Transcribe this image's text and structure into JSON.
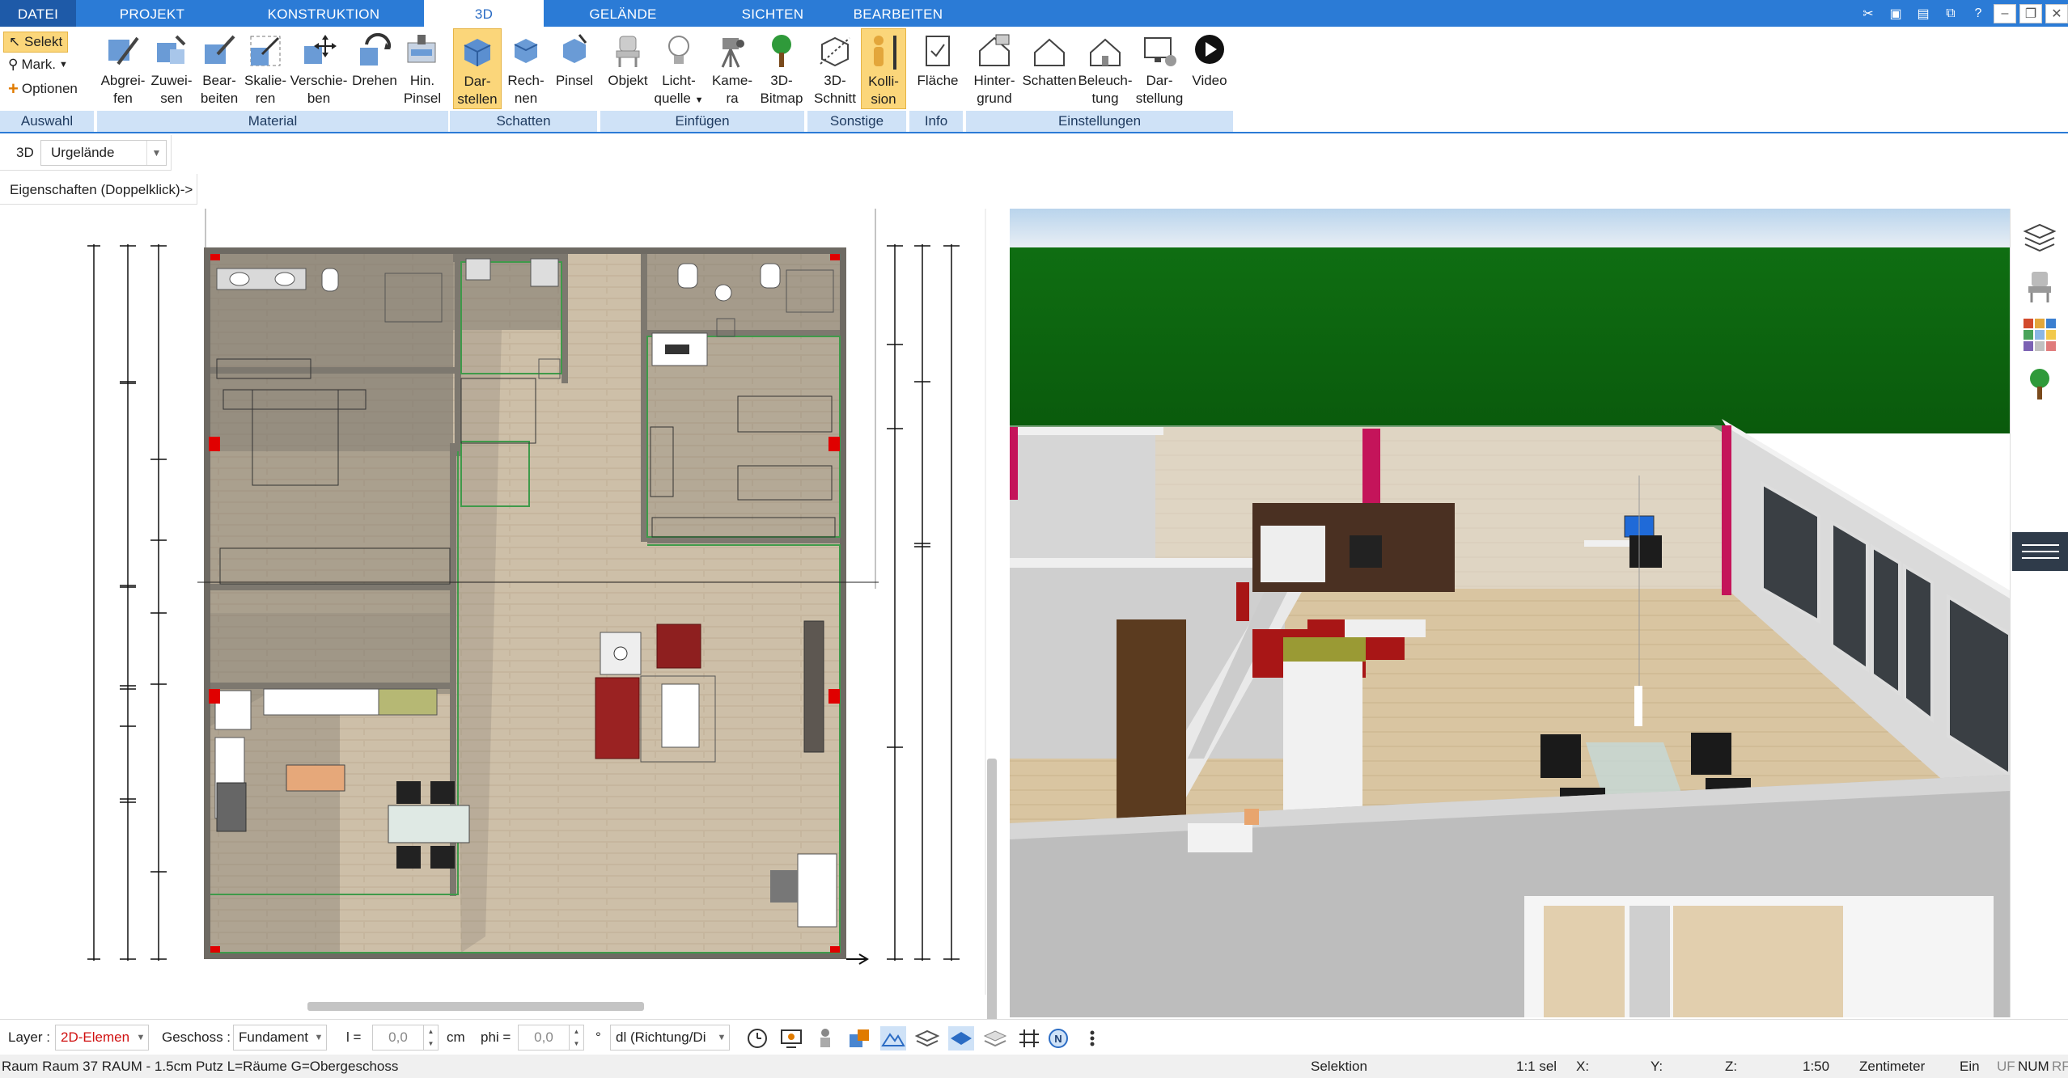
{
  "tabs": [
    {
      "label": "DATEI"
    },
    {
      "label": "PROJEKT"
    },
    {
      "label": "KONSTRUKTION"
    },
    {
      "label": "3D"
    },
    {
      "label": "GELÄNDE"
    },
    {
      "label": "SICHTEN"
    },
    {
      "label": "BEARBEITEN"
    }
  ],
  "ribbon": {
    "auswahl": {
      "selekt": "Selekt",
      "mark": "Mark.",
      "optionen": "Optionen",
      "title": "Auswahl"
    },
    "material": {
      "title": "Material",
      "buttons": [
        {
          "l1": "Abgrei-",
          "l2": "fen",
          "icon": "eyedropper-icon"
        },
        {
          "l1": "Zuwei-",
          "l2": "sen",
          "icon": "assign-material-icon"
        },
        {
          "l1": "Bear-",
          "l2": "beiten",
          "icon": "edit-material-icon"
        },
        {
          "l1": "Skalie-",
          "l2": "ren",
          "icon": "scale-icon"
        },
        {
          "l1": "Verschie-",
          "l2": "ben",
          "icon": "move-icon"
        },
        {
          "l1": "Drehen",
          "l2": "",
          "icon": "rotate-icon"
        },
        {
          "l1": "Hin.",
          "l2": "Pinsel",
          "icon": "pointer-brush-icon"
        }
      ]
    },
    "schatten": {
      "title": "Schatten",
      "buttons": [
        {
          "l1": "Dar-",
          "l2": "stellen",
          "icon": "shadow-display-icon"
        },
        {
          "l1": "Rech-",
          "l2": "nen",
          "icon": "shadow-calc-icon"
        },
        {
          "l1": "Pinsel",
          "l2": "",
          "icon": "shadow-brush-icon"
        }
      ]
    },
    "einfuegen": {
      "title": "Einfügen",
      "buttons": [
        {
          "l1": "Objekt",
          "l2": "",
          "icon": "chair-object-icon"
        },
        {
          "l1": "Licht-",
          "l2": "quelle",
          "icon": "light-bulb-icon"
        },
        {
          "l1": "Kame-",
          "l2": "ra",
          "icon": "camera-icon"
        },
        {
          "l1": "3D-",
          "l2": "Bitmap",
          "icon": "tree-bitmap-icon"
        }
      ]
    },
    "sonstige": {
      "title": "Sonstige",
      "buttons": [
        {
          "l1": "3D-",
          "l2": "Schnitt",
          "icon": "cut-3d-icon"
        },
        {
          "l1": "Kolli-",
          "l2": "sion",
          "icon": "collision-person-icon"
        }
      ]
    },
    "info": {
      "title": "Info",
      "buttons": [
        {
          "l1": "Fläche",
          "l2": "",
          "icon": "area-icon"
        }
      ]
    },
    "einstellungen": {
      "title": "Einstellungen",
      "buttons": [
        {
          "l1": "Hinter-",
          "l2": "grund",
          "icon": "background-icon"
        },
        {
          "l1": "Schatten",
          "l2": "",
          "icon": "house-shadow-icon"
        },
        {
          "l1": "Beleuch-",
          "l2": "tung",
          "icon": "lighting-icon"
        },
        {
          "l1": "Dar-",
          "l2": "stellung",
          "icon": "display-settings-icon"
        },
        {
          "l1": "Video",
          "l2": "",
          "icon": "video-play-icon"
        }
      ]
    }
  },
  "subbar": {
    "label3d": "3D",
    "terrain": "Urgelände",
    "properties": "Eigenschaften (Doppelklick)->"
  },
  "bottombar": {
    "layer_label": "Layer :",
    "layer_value": "2D-Elemen",
    "geschoss_label": "Geschoss :",
    "geschoss_value": "Fundament",
    "l_label": "l =",
    "l_value": "0,0",
    "l_unit": "cm",
    "phi_label": "phi =",
    "phi_value": "0,0",
    "phi_unit": "°",
    "dl_value": "dl (Richtung/Di"
  },
  "statusbar": {
    "info": "Raum Raum 37 RAUM - 1.5cm Putz L=Räume G=Obergeschoss",
    "mode": "Selektion",
    "sel": "1:1 sel",
    "x": "X:",
    "y": "Y:",
    "z": "Z:",
    "scale": "1:50",
    "unit": "Zentimeter",
    "ein": "Ein",
    "uf": "UF",
    "num": "NUM",
    "rf": "RF"
  },
  "colors": {
    "accent": "#2b7bd6",
    "ribbon_group": "#cfe2f7",
    "selected": "#fbd67a",
    "sky": "#0d6a0d",
    "floor": "#d8c4a0"
  }
}
